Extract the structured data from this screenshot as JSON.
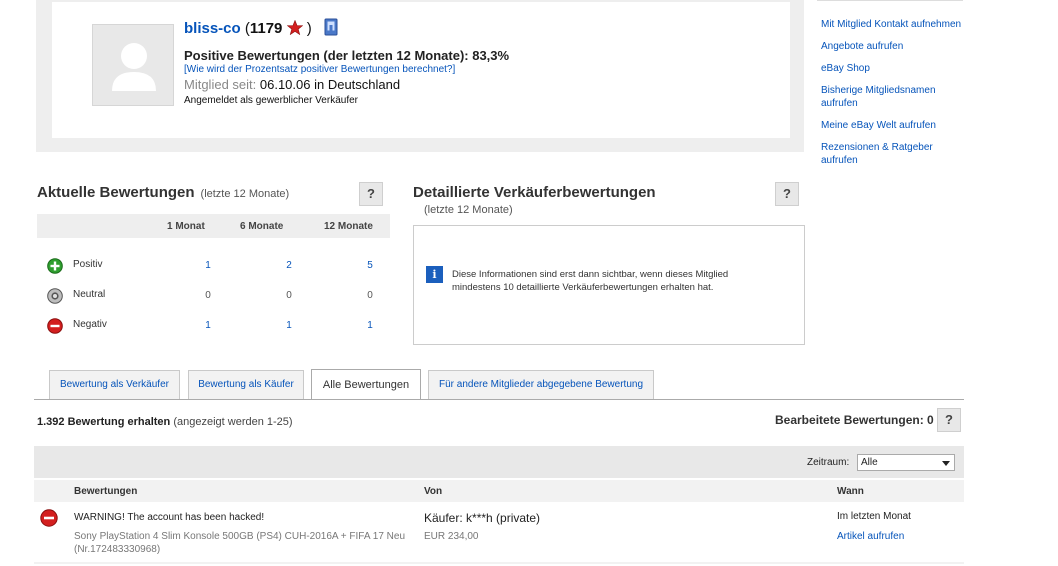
{
  "profile": {
    "username": "bliss-co",
    "score": "1179",
    "open_paren": "(",
    "close_paren": ")",
    "positive_label": "Positive Bewertungen (der letzten 12 Monate): 83,3%",
    "how_calculated": "[Wie wird der Prozentsatz positiver Bewertungen berechnet?]",
    "member_since_label": "Mitglied seit:",
    "member_since_value": "06.10.06 in Deutschland",
    "seller_type": "Angemeldet als gewerblicher Verkäufer"
  },
  "right_links": [
    "Mit Mitglied Kontakt aufnehmen",
    "Angebote aufrufen",
    "eBay Shop",
    "Bisherige Mitgliedsnamen aufrufen",
    "Meine eBay Welt aufrufen",
    "Rezensionen & Ratgeber aufrufen"
  ],
  "current_ratings": {
    "title": "Aktuelle Bewertungen",
    "subtitle": "(letzte 12 Monate)",
    "help": "?",
    "columns": [
      "1 Monat",
      "6 Monate",
      "12 Monate"
    ],
    "rows": [
      {
        "label": "Positiv",
        "values": [
          "1",
          "2",
          "5"
        ],
        "icon": "positive-icon"
      },
      {
        "label": "Neutral",
        "values": [
          "0",
          "0",
          "0"
        ],
        "icon": "neutral-icon"
      },
      {
        "label": "Negativ",
        "values": [
          "1",
          "1",
          "1"
        ],
        "icon": "negative-icon"
      }
    ]
  },
  "detailed_ratings": {
    "title": "Detaillierte Verkäuferbewertungen",
    "subtitle": "(letzte 12 Monate)",
    "help": "?",
    "info_text": "Diese Informationen sind erst dann sichtbar, wenn dieses Mitglied mindestens 10 detaillierte Verkäuferbewertungen erhalten hat."
  },
  "tabs": [
    {
      "label": "Bewertung als Verkäufer",
      "active": false
    },
    {
      "label": "Bewertung als Käufer",
      "active": false
    },
    {
      "label": "Alle Bewertungen",
      "active": true
    },
    {
      "label": "Für andere Mitglieder abgegebene Bewertung",
      "active": false
    }
  ],
  "summary": {
    "received_count": "1.392 Bewertung erhalten",
    "shown_range": "(angezeigt werden 1-25)",
    "edited_label": "Bearbeitete Bewertungen: 0",
    "help": "?"
  },
  "filter": {
    "period_label": "Zeitraum:",
    "period_value": "Alle"
  },
  "list_columns": {
    "comment": "Bewertungen",
    "from": "Von",
    "when": "Wann"
  },
  "entries": [
    {
      "icon": "negative-icon",
      "comment": "WARNING! The account has been hacked!",
      "item": "Sony PlayStation 4 Slim Konsole 500GB (PS4) CUH-2016A + FIFA 17 Neu (Nr.172483330968)",
      "from": "Käufer: k***h (private)",
      "price": "EUR 234,00",
      "when": "Im letzten Monat",
      "view_item": "Artikel aufrufen"
    }
  ],
  "colors": {
    "link": "#0654ba",
    "positive": "#2f9e2f",
    "negative": "#d31f1f",
    "neutral": "#888888",
    "star": "#d31f1f"
  }
}
